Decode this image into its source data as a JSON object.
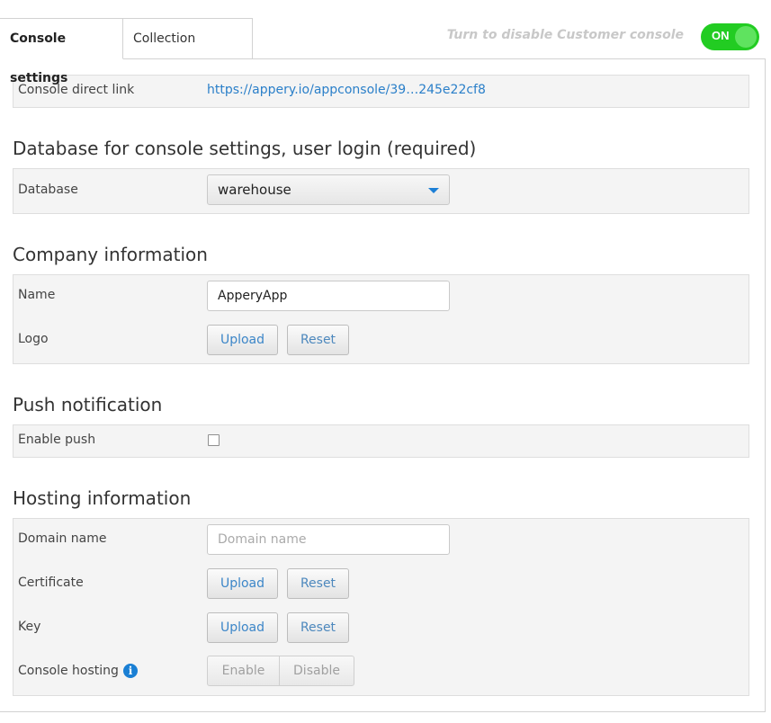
{
  "tabs": [
    {
      "label": "Console settings",
      "active": true
    },
    {
      "label": "Collection settings",
      "active": false
    }
  ],
  "toggle": {
    "hint": "Turn to disable Customer console",
    "label": "ON",
    "state": "on",
    "color": "#22cc22"
  },
  "console_link": {
    "label": "Console direct link",
    "url": "https://appery.io/appconsole/39…245e22cf8"
  },
  "database_section": {
    "title": "Database for console settings, user login (required)",
    "label": "Database",
    "selected": "warehouse"
  },
  "company_section": {
    "title": "Company information",
    "name_label": "Name",
    "name_value": "ApperyApp",
    "logo_label": "Logo",
    "upload_label": "Upload",
    "reset_label": "Reset"
  },
  "push_section": {
    "title": "Push notification",
    "enable_label": "Enable push",
    "enabled": false
  },
  "hosting_section": {
    "title": "Hosting information",
    "domain_label": "Domain name",
    "domain_value": "",
    "domain_placeholder": "Domain name",
    "certificate_label": "Certificate",
    "key_label": "Key",
    "upload_label": "Upload",
    "reset_label": "Reset",
    "hosting_label": "Console hosting",
    "info_icon": "info-icon",
    "enable_label": "Enable",
    "disable_label": "Disable"
  },
  "colors": {
    "accent": "#2a7fc9",
    "toggle_on": "#22cc22",
    "panel_bg": "#f4f4f4"
  }
}
